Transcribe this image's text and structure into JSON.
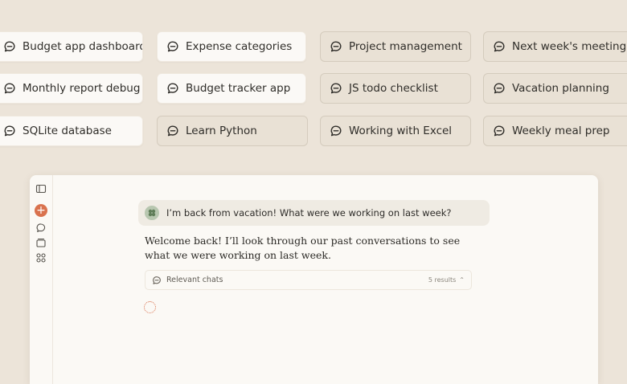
{
  "chips": [
    {
      "label": "Budget app dashboard",
      "style": "light"
    },
    {
      "label": "Expense categories",
      "style": "light"
    },
    {
      "label": "Project management",
      "style": "outline"
    },
    {
      "label": "Next week's meeting",
      "style": "outline"
    },
    {
      "label": "Monthly report debug",
      "style": "light"
    },
    {
      "label": "Budget tracker app",
      "style": "light"
    },
    {
      "label": "JS todo checklist",
      "style": "outline"
    },
    {
      "label": "Vacation planning",
      "style": "outline"
    },
    {
      "label": "SQLite database",
      "style": "light"
    },
    {
      "label": "Learn Python",
      "style": "outline"
    },
    {
      "label": "Working with Excel",
      "style": "outline"
    },
    {
      "label": "Weekly meal prep",
      "style": "outline"
    }
  ],
  "chat": {
    "user_message": "I’m back from vacation! What were we working on last week?",
    "assistant_reply": "Welcome back! I’ll look through our past conversations to see what we were working on last week.",
    "relevant_label": "Relevant chats",
    "relevant_count": "5 results",
    "chevron": "⌃"
  },
  "sidebar": {
    "new_chat_glyph": "+"
  },
  "colors": {
    "background": "#ece4d9",
    "accent": "#d9724e",
    "avatar": "#b8c7b0"
  },
  "icons": {
    "chip": "chat-bubble-icon",
    "sidebar": [
      "sidebar-toggle-icon",
      "new-chat-icon",
      "chats-icon",
      "projects-icon",
      "artifacts-icon"
    ]
  }
}
